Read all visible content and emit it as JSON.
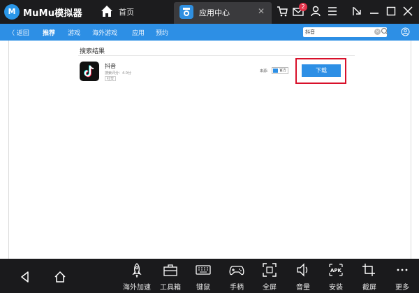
{
  "titlebar": {
    "app_name": "MuMu模拟器",
    "home_tab_label": "首页",
    "active_tab_label": "应用中心",
    "notification_count": "2",
    "logo_letter": "M"
  },
  "nav": {
    "back": "〈 返回",
    "items": [
      "推荐",
      "游戏",
      "海外游戏",
      "应用",
      "预约"
    ],
    "search_value": "抖音"
  },
  "results": {
    "title": "搜索结果",
    "app": {
      "name": "抖音",
      "rating": "搜索评分：4.0分",
      "tag": "社交",
      "source_label": "来源：",
      "source_name": "官方",
      "download_label": "下载"
    }
  },
  "toolbar": {
    "items": [
      "海外加速",
      "工具箱",
      "键鼠",
      "手柄",
      "全屏",
      "音量",
      "安装",
      "截屏",
      "更多"
    ]
  },
  "colors": {
    "accent": "#2d8fe5",
    "highlight": "#d8102a",
    "dark": "#1c1c1e"
  }
}
